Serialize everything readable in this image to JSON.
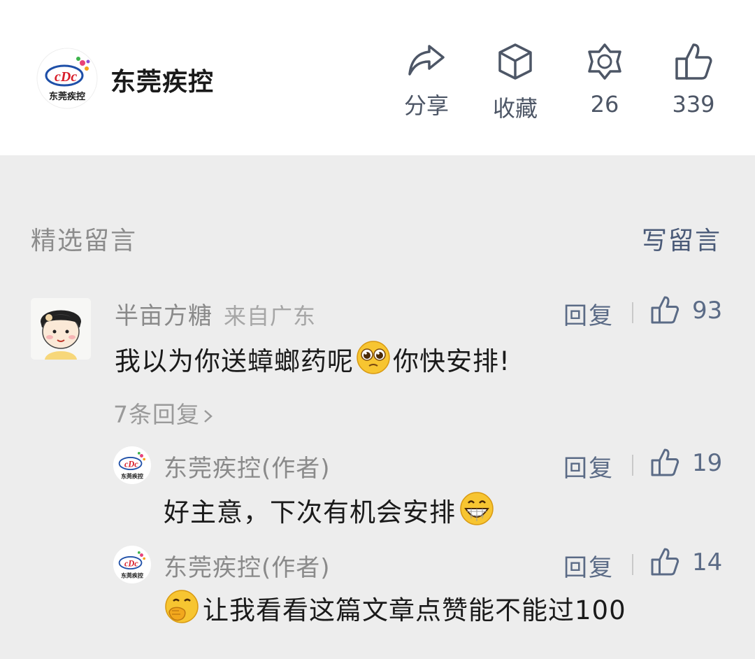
{
  "account": {
    "name": "东莞疾控",
    "logo_text": "东莞疾控"
  },
  "actions": {
    "share_label": "分享",
    "favorite_label": "收藏",
    "wow_count": "26",
    "like_count": "339"
  },
  "comments_section": {
    "title": "精选留言",
    "write_label": "写留言"
  },
  "comment": {
    "nickname": "半亩方糖",
    "location": "来自广东",
    "text_before": "我以为你送蟑螂药呢",
    "emoji_name": "pleading-face-emoji",
    "text_after": "你快安排!",
    "reply_label": "回复",
    "likes": "93",
    "more_replies": "7条回复"
  },
  "replies": [
    {
      "nickname": "东莞疾控(作者)",
      "text": "好主意，下次有机会安排",
      "emoji_name": "grinning-face-emoji",
      "reply_label": "回复",
      "likes": "19"
    },
    {
      "nickname": "东莞疾控(作者)",
      "text": "让我看看这篇文章点赞能不能过100",
      "emoji_name": "hand-over-mouth-emoji",
      "reply_label": "回复",
      "likes": "14"
    }
  ],
  "colors": {
    "link": "#5b6b86",
    "muted": "#8a8a8a",
    "background": "#ededed",
    "header": "#ffffff"
  }
}
